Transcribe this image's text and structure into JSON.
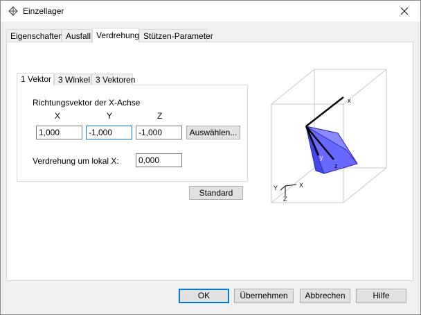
{
  "window": {
    "title": "Einzellager"
  },
  "outer_tabs": [
    "Eigenschaften",
    "Ausfall",
    "Verdrehung",
    "Stützen-Parameter"
  ],
  "inner_tabs": [
    "1 Vektor",
    "3 Winkel",
    "3 Vektoren"
  ],
  "vector": {
    "heading": "Richtungsvektor der X-Achse",
    "col_x": "X",
    "col_y": "Y",
    "col_z": "Z",
    "x_value": "1,000",
    "y_value": "-1,000",
    "z_value": "-1,000",
    "select_button": "Auswählen..."
  },
  "twist": {
    "label": "Verdrehung um lokal X:",
    "value": "0,000"
  },
  "standard_button": "Standard",
  "preview": {
    "axis_x": "x",
    "axis_y": "y",
    "axis_z": "z",
    "legend_x": "X",
    "legend_y": "Y",
    "legend_z": "Z"
  },
  "footer": {
    "ok": "OK",
    "apply": "Übernehmen",
    "cancel": "Abbrechen",
    "help": "Hilfe"
  },
  "colors": {
    "accent": "#0078d7",
    "support_fill": "#5a5aff"
  }
}
